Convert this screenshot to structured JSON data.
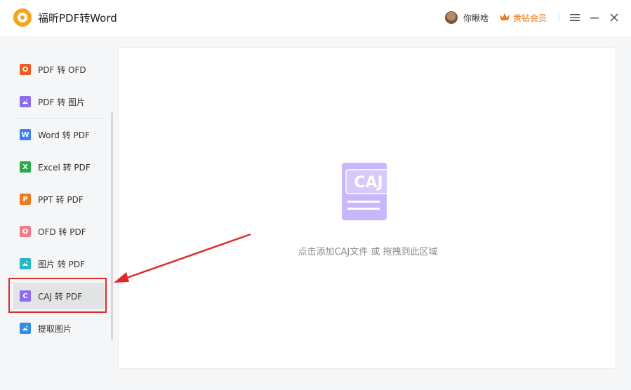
{
  "app": {
    "title": "福昕PDF转Word"
  },
  "header": {
    "user_name": "你瞅啥",
    "vip_label": "黄钻会员",
    "icons": [
      "user-avatar",
      "crown-icon",
      "menu-icon",
      "minimize-icon",
      "close-icon"
    ]
  },
  "sidebar": {
    "items": [
      {
        "label": "PDF 转 OFD",
        "icon": "O",
        "color": "#f05a22"
      },
      {
        "label": "PDF 转 图片",
        "icon": "image-icon",
        "color": "#8d6bf2"
      },
      {
        "label": "Word 转 PDF",
        "icon": "W",
        "color": "#3d7ff5"
      },
      {
        "label": "Excel 转 PDF",
        "icon": "X",
        "color": "#2aa84a"
      },
      {
        "label": "PPT 转 PDF",
        "icon": "P",
        "color": "#f07a1d"
      },
      {
        "label": "OFD 转 PDF",
        "icon": "O",
        "color": "#f27a8a"
      },
      {
        "label": "图片 转 PDF",
        "icon": "image-icon",
        "color": "#25b8c6"
      },
      {
        "label": "CAJ 转 PDF",
        "icon": "C",
        "color": "#8d6bf2",
        "active": true
      },
      {
        "label": "提取图片",
        "icon": "image-icon",
        "color": "#2f8fe6"
      }
    ]
  },
  "main": {
    "drop_icon_text": "CAJ",
    "drop_hint": "点击添加CAJ文件 或 拖拽到此区域",
    "colors": {
      "file_icon": "#c9b7fb",
      "annotation": "#e02b2b"
    }
  }
}
